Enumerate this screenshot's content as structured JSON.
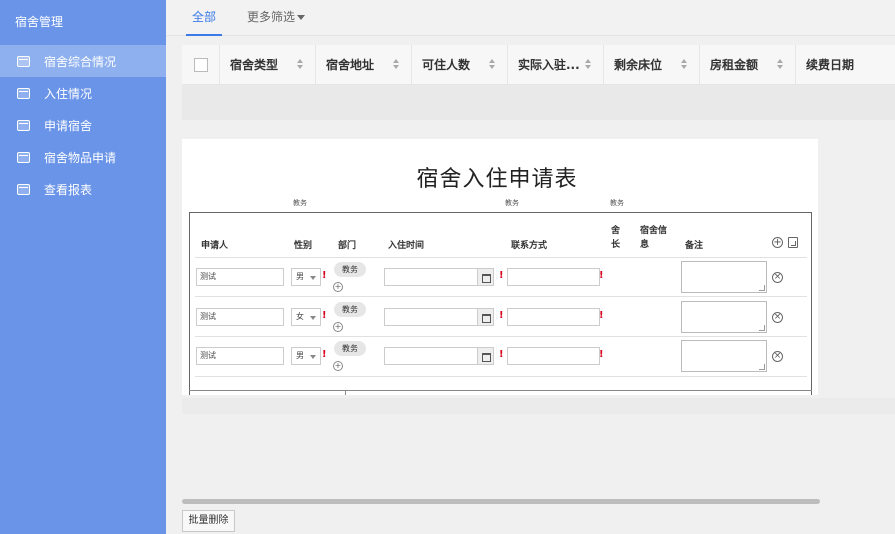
{
  "sidebar": {
    "title": "宿舍管理",
    "items": [
      {
        "label": "宿舍综合情况"
      },
      {
        "label": "入住情况"
      },
      {
        "label": "申请宿舍"
      },
      {
        "label": "宿舍物品申请"
      },
      {
        "label": "查看报表"
      }
    ]
  },
  "tabs": {
    "all": "全部",
    "more": "更多筛选"
  },
  "grid": {
    "columns": [
      "宿舍类型",
      "宿舍地址",
      "可住人数",
      "实际入驻...",
      "剩余床位",
      "房租金额",
      "续费日期"
    ]
  },
  "form": {
    "title": "宿舍入住申请表",
    "notes": [
      "教务",
      "教务",
      "教务"
    ],
    "headers": {
      "applicant": "申请人",
      "gender": "性别",
      "dept": "部门",
      "checkin": "入住时间",
      "contact": "联系方式",
      "leader": "舍长",
      "dorm_info": "宿舍信息",
      "remark": "备注"
    },
    "rows": [
      {
        "name": "测试",
        "gender": "男",
        "dept": "教务"
      },
      {
        "name": "测试",
        "gender": "女",
        "dept": "教务"
      },
      {
        "name": "测试",
        "gender": "男",
        "dept": "教务"
      }
    ]
  },
  "footer": {
    "batch_delete": "批量删除"
  }
}
